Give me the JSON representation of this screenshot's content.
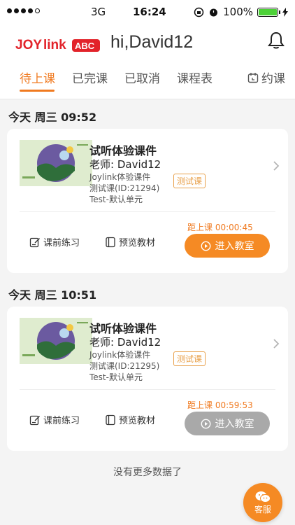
{
  "status_bar": {
    "carrier": "3G",
    "time": "16:24",
    "battery": "100%"
  },
  "header": {
    "logo_text": "Joylink",
    "logo_badge": "ABC",
    "greeting": "hi,David12"
  },
  "tabs": [
    {
      "label": "待上课",
      "active": true
    },
    {
      "label": "已完课",
      "active": false
    },
    {
      "label": "已取消",
      "active": false
    },
    {
      "label": "课程表",
      "active": false
    }
  ],
  "book_tab": {
    "label": "约课"
  },
  "lessons": [
    {
      "date": "今天 周三 09:52",
      "title": "试听体验课件",
      "teacher": "老师: David12",
      "line1": "Joylink体验课件",
      "line2": "测试课(ID:21294)",
      "line3": "Test-默认单元",
      "badge": "测试课",
      "practice": "课前练习",
      "preview": "预览教材",
      "countdown": "距上课 00:00:45",
      "enter": "进入教室",
      "enter_enabled": true
    },
    {
      "date": "今天 周三 10:51",
      "title": "试听体验课件",
      "teacher": "老师: David12",
      "line1": "Joylink体验课件",
      "line2": "测试课(ID:21295)",
      "line3": "Test-默认单元",
      "badge": "测试课",
      "practice": "课前练习",
      "preview": "预览教材",
      "countdown": "距上课 00:59:53",
      "enter": "进入教室",
      "enter_enabled": false
    }
  ],
  "footer": {
    "no_more": "没有更多数据了",
    "service_label": "客服"
  },
  "colors": {
    "accent": "#f07a20",
    "button_orange": "#f58a24",
    "button_disabled": "#a9a9a9",
    "logo_red": "#e2232a"
  }
}
